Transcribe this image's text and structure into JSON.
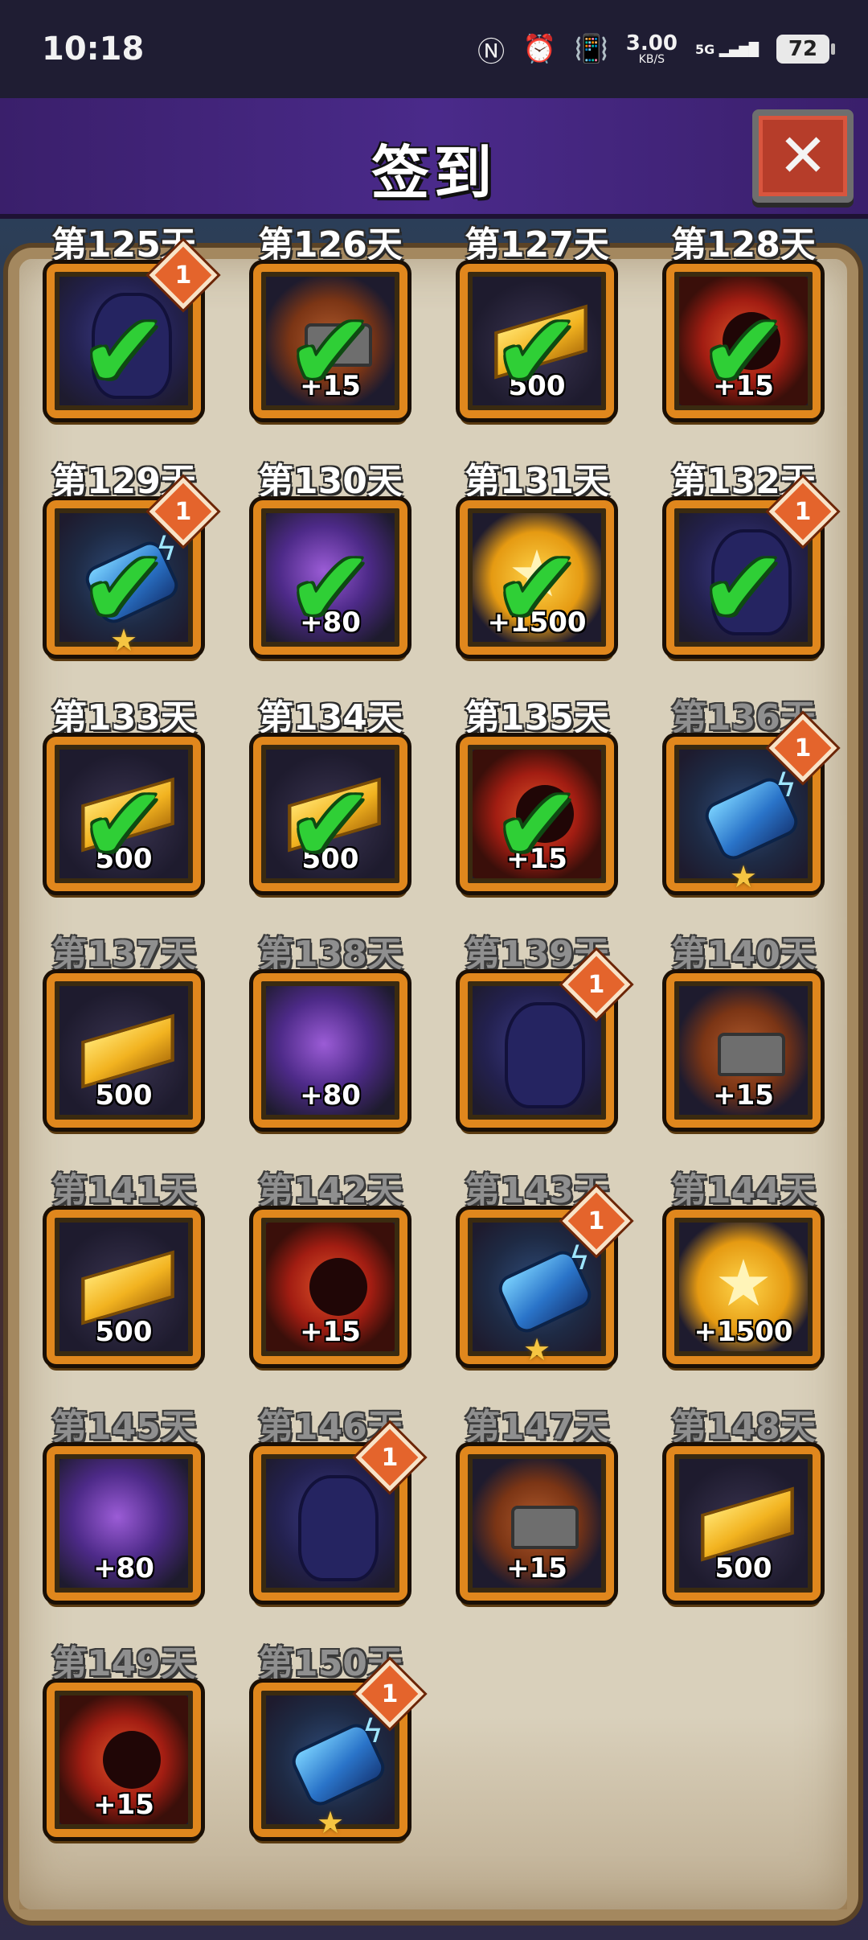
{
  "status_bar": {
    "time": "10:18",
    "icons": [
      "nfc-icon",
      "alarm-icon",
      "vibrate-icon",
      "network-speed",
      "5g-signal-icon",
      "battery-icon"
    ],
    "network_speed_value": "3.00",
    "network_speed_unit": "KB/S",
    "network_type": "5G",
    "battery": "72"
  },
  "header": {
    "title": "签到",
    "close_icon": "close-icon"
  },
  "rewards": [
    {
      "day": "第125天",
      "type": "dragon",
      "qty": "",
      "badge": "1",
      "claimed": true
    },
    {
      "day": "第126天",
      "type": "forge",
      "qty": "+15",
      "badge": "",
      "claimed": true
    },
    {
      "day": "第127天",
      "type": "gold",
      "qty": "500",
      "badge": "",
      "claimed": true
    },
    {
      "day": "第128天",
      "type": "demon",
      "qty": "+15",
      "badge": "",
      "claimed": true
    },
    {
      "day": "第129天",
      "type": "gauntlet",
      "qty": "",
      "badge": "1",
      "claimed": true,
      "star": true
    },
    {
      "day": "第130天",
      "type": "galaxy",
      "qty": "+80",
      "badge": "",
      "claimed": true
    },
    {
      "day": "第131天",
      "type": "coin",
      "qty": "+1500",
      "badge": "",
      "claimed": true
    },
    {
      "day": "第132天",
      "type": "dragon",
      "qty": "",
      "badge": "1",
      "claimed": true
    },
    {
      "day": "第133天",
      "type": "gold",
      "qty": "500",
      "badge": "",
      "claimed": true
    },
    {
      "day": "第134天",
      "type": "gold",
      "qty": "500",
      "badge": "",
      "claimed": true
    },
    {
      "day": "第135天",
      "type": "demon",
      "qty": "+15",
      "badge": "",
      "claimed": true
    },
    {
      "day": "第136天",
      "type": "gauntlet",
      "qty": "",
      "badge": "1",
      "claimed": false,
      "star": true
    },
    {
      "day": "第137天",
      "type": "gold",
      "qty": "500",
      "badge": "",
      "claimed": false
    },
    {
      "day": "第138天",
      "type": "galaxy",
      "qty": "+80",
      "badge": "",
      "claimed": false
    },
    {
      "day": "第139天",
      "type": "dragon",
      "qty": "",
      "badge": "1",
      "claimed": false
    },
    {
      "day": "第140天",
      "type": "forge",
      "qty": "+15",
      "badge": "",
      "claimed": false
    },
    {
      "day": "第141天",
      "type": "gold",
      "qty": "500",
      "badge": "",
      "claimed": false
    },
    {
      "day": "第142天",
      "type": "demon",
      "qty": "+15",
      "badge": "",
      "claimed": false
    },
    {
      "day": "第143天",
      "type": "gauntlet",
      "qty": "",
      "badge": "1",
      "claimed": false,
      "star": true
    },
    {
      "day": "第144天",
      "type": "coin",
      "qty": "+1500",
      "badge": "",
      "claimed": false
    },
    {
      "day": "第145天",
      "type": "galaxy",
      "qty": "+80",
      "badge": "",
      "claimed": false
    },
    {
      "day": "第146天",
      "type": "dragon",
      "qty": "",
      "badge": "1",
      "claimed": false
    },
    {
      "day": "第147天",
      "type": "forge",
      "qty": "+15",
      "badge": "",
      "claimed": false
    },
    {
      "day": "第148天",
      "type": "gold",
      "qty": "500",
      "badge": "",
      "claimed": false
    },
    {
      "day": "第149天",
      "type": "demon",
      "qty": "+15",
      "badge": "",
      "claimed": false
    },
    {
      "day": "第150天",
      "type": "gauntlet",
      "qty": "",
      "badge": "1",
      "claimed": false,
      "star": true
    }
  ]
}
